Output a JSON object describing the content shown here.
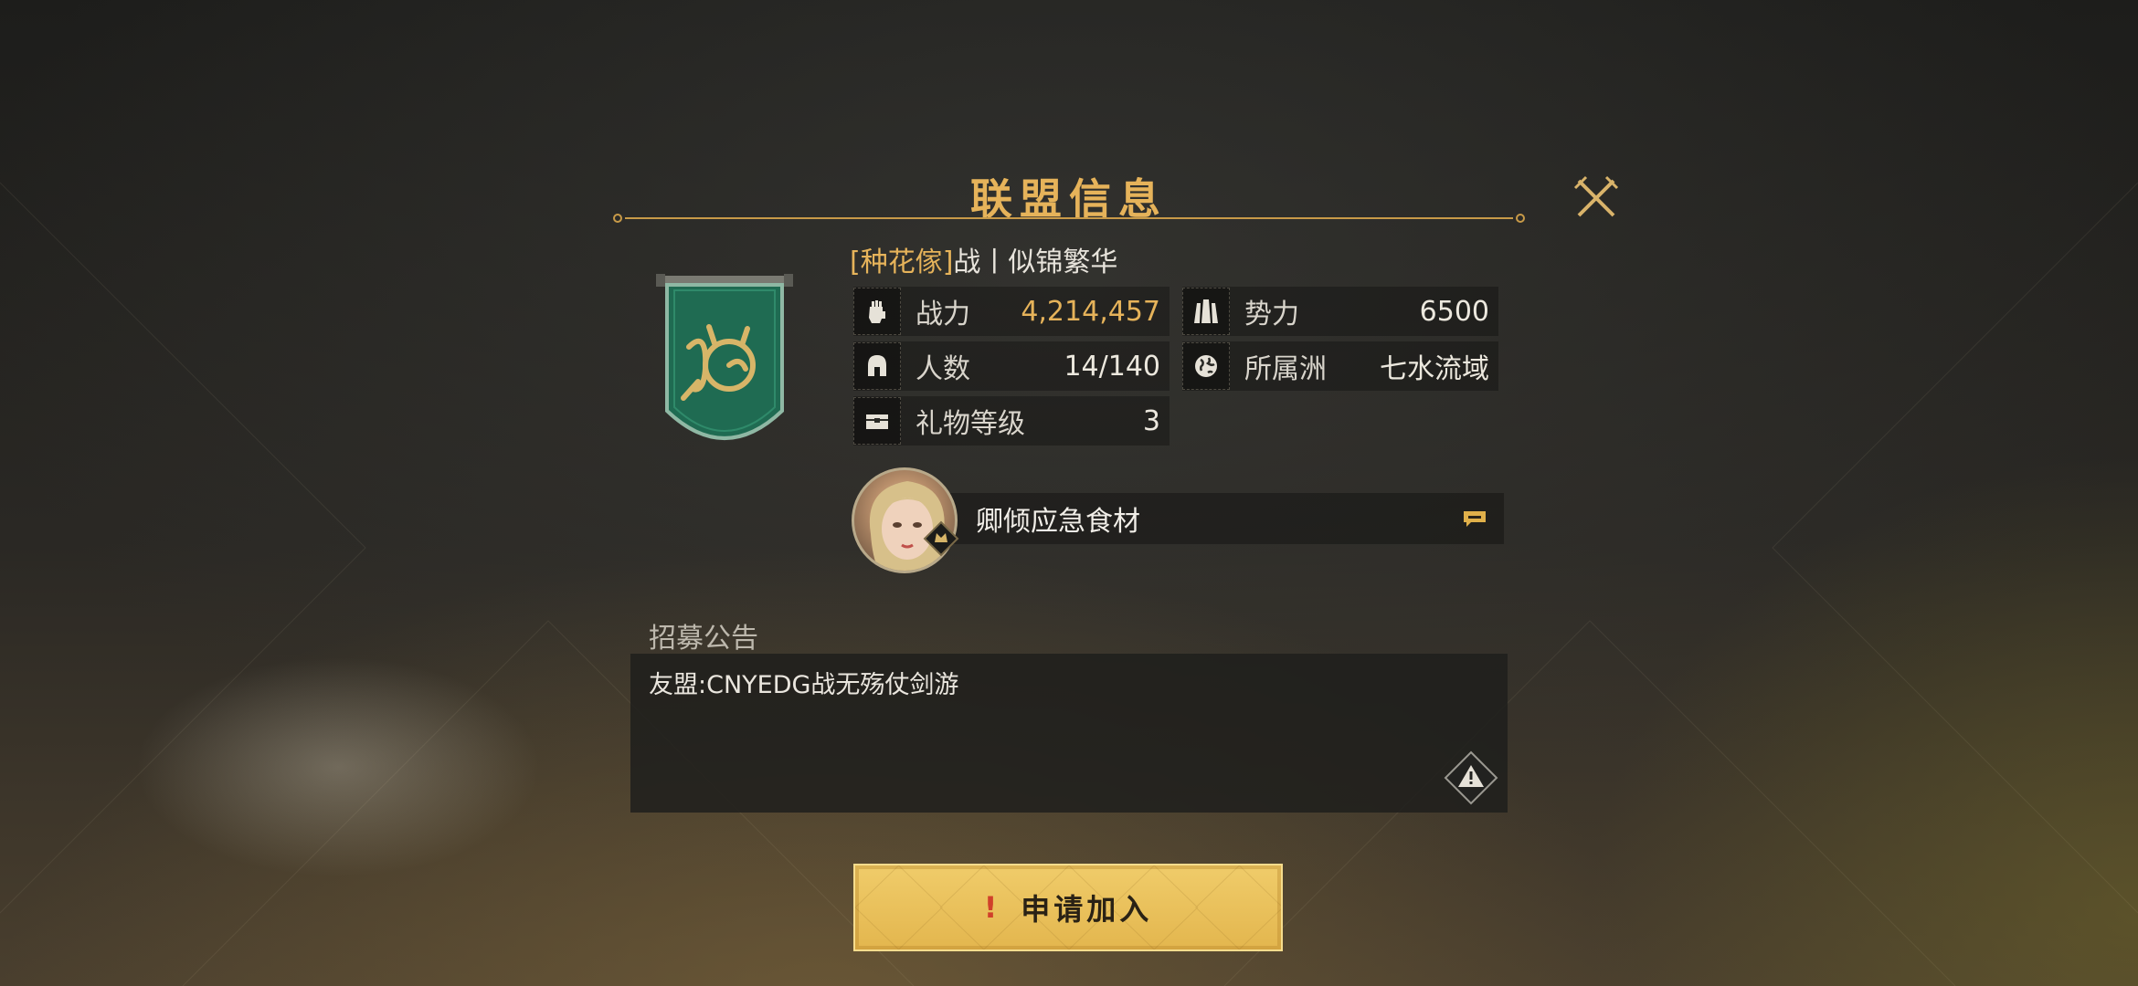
{
  "dialog": {
    "title": "联盟信息"
  },
  "guild": {
    "tag": "[种花傢]",
    "name": "战丨似锦繁华",
    "stats": {
      "power": {
        "label": "战力",
        "value": "4,214,457",
        "icon": "fist-icon"
      },
      "influence": {
        "label": "势力",
        "value": "6500",
        "icon": "fortress-icon"
      },
      "members": {
        "label": "人数",
        "value": "14/140",
        "icon": "helmet-icon"
      },
      "region": {
        "label": "所属洲",
        "value": "七水流域",
        "icon": "globe-icon"
      },
      "gift_level": {
        "label": "礼物等级",
        "value": "3",
        "icon": "chest-icon"
      }
    }
  },
  "leader": {
    "name": "卿倾应急食材",
    "chat_icon": "chat-icon"
  },
  "recruit": {
    "label": "招募公告",
    "text": "友盟:CNYEDG战无殇仗剑游"
  },
  "join_button": {
    "excl": "!",
    "label": "申请加入"
  },
  "colors": {
    "gold": "#e6b35a",
    "banner_green": "#1f6b52",
    "button_yellow": "#e8bd55"
  }
}
